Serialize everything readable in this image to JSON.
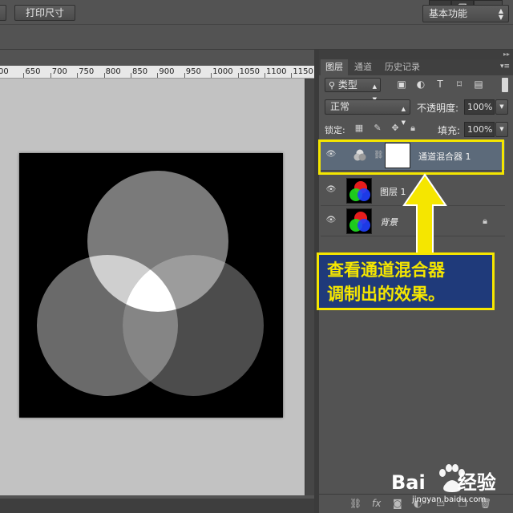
{
  "window": {
    "minimize_icon": "minimize-icon",
    "restore_icon": "restore-icon",
    "close_icon": "close-icon"
  },
  "options_bar": {
    "print_size_label": "打印尺寸",
    "workspace": "基本功能"
  },
  "ruler": {
    "ticks": [
      "00",
      "650",
      "700",
      "750",
      "800",
      "850",
      "900",
      "950",
      "1000",
      "1050",
      "1100",
      "1150"
    ]
  },
  "panel": {
    "tabs": [
      {
        "label": "图层",
        "active": true
      },
      {
        "label": "通道",
        "active": false
      },
      {
        "label": "历史记录",
        "active": false
      }
    ],
    "filter_type": "类型",
    "blend_mode": "正常",
    "opacity_label": "不透明度:",
    "opacity_value": "100%",
    "lock_label": "锁定:",
    "fill_label": "填充:",
    "fill_value": "100%",
    "layers": [
      {
        "name": "通道混合器 1",
        "type": "adjustment",
        "selected": true
      },
      {
        "name": "图层 1",
        "type": "pixel",
        "selected": false
      },
      {
        "name": "背景",
        "type": "background",
        "selected": false,
        "locked": true
      }
    ]
  },
  "annotation": {
    "line1": "查看通道混合器",
    "line2": "调制出的效果。",
    "color": "#f5e600",
    "bg": "#1f3a7a"
  },
  "watermark": {
    "brand": "Bai",
    "suffix": "经验",
    "url": "jingyan.baidu.com"
  }
}
